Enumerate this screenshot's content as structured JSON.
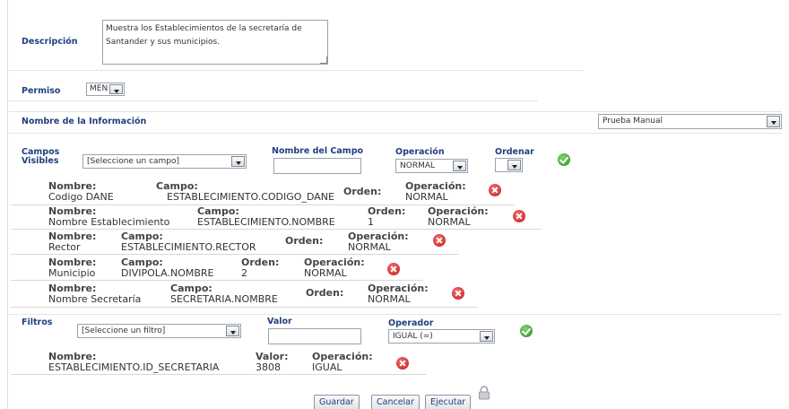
{
  "header": {
    "descripcion_label": "Descripción",
    "descripcion_value": "Muestra los Establecimientos de la secretaría de Santander y sus municipios.",
    "permiso_label": "Permiso",
    "permiso_value": "MEN",
    "nombre_info_label": "Nombre de la Información",
    "nombre_info_value": "Prueba Manual"
  },
  "campos": {
    "label_line1": "Campos",
    "label_line2": "Visibles",
    "select_placeholder": "[Seleccione un campo]",
    "nombre_campo_label": "Nombre del Campo",
    "nombre_campo_value": "",
    "operacion_label": "Operación",
    "operacion_value": "NORMAL",
    "ordenar_label": "Ordenar",
    "ordenar_value": "",
    "rows": [
      {
        "nombre_label": "Nombre:",
        "nombre": "Codigo DANE",
        "campo_label": "Campo:",
        "campo": "ESTABLECIMIENTO.CODIGO_DANE",
        "orden_label": "Orden:",
        "orden": "",
        "operacion_label": "Operación:",
        "operacion": "NORMAL"
      },
      {
        "nombre_label": "Nombre:",
        "nombre": "Nombre Establecimiento",
        "campo_label": "Campo:",
        "campo": "ESTABLECIMIENTO.NOMBRE",
        "orden_label": "Orden:",
        "orden": "1",
        "operacion_label": "Operación:",
        "operacion": "NORMAL"
      },
      {
        "nombre_label": "Nombre:",
        "nombre": "Rector",
        "campo_label": "Campo:",
        "campo": "ESTABLECIMIENTO.RECTOR",
        "orden_label": "Orden:",
        "orden": "",
        "operacion_label": "Operación:",
        "operacion": "NORMAL"
      },
      {
        "nombre_label": "Nombre:",
        "nombre": "Municipio",
        "campo_label": "Campo:",
        "campo": "DIVIPOLA.NOMBRE",
        "orden_label": "Orden:",
        "orden": "2",
        "operacion_label": "Operación:",
        "operacion": "NORMAL"
      },
      {
        "nombre_label": "Nombre:",
        "nombre": "Nombre Secretaría",
        "campo_label": "Campo:",
        "campo": "SECRETARIA.NOMBRE",
        "orden_label": "Orden:",
        "orden": "",
        "operacion_label": "Operación:",
        "operacion": "NORMAL"
      }
    ]
  },
  "filtros": {
    "label": "Filtros",
    "select_placeholder": "[Seleccione un filtro]",
    "valor_label": "Valor",
    "valor_value": "",
    "operador_label": "Operador",
    "operador_value": "IGUAL (=)",
    "rows": [
      {
        "nombre_label": "Nombre:",
        "nombre": "ESTABLECIMIENTO.ID_SECRETARIA",
        "valor_label": "Valor:",
        "valor": "3808",
        "operacion_label": "Operación:",
        "operacion": "IGUAL"
      }
    ]
  },
  "actions": {
    "guardar": "Guardar",
    "cancelar": "Cancelar",
    "ejecutar": "Ejecutar"
  },
  "icons": {
    "remove": "remove-x-icon",
    "confirm": "check-ok-icon",
    "lock": "lock-icon"
  },
  "colors": {
    "label_blue": "#1f3f7f",
    "remove_red": "#c41a1a",
    "confirm_green": "#2e8b22"
  }
}
